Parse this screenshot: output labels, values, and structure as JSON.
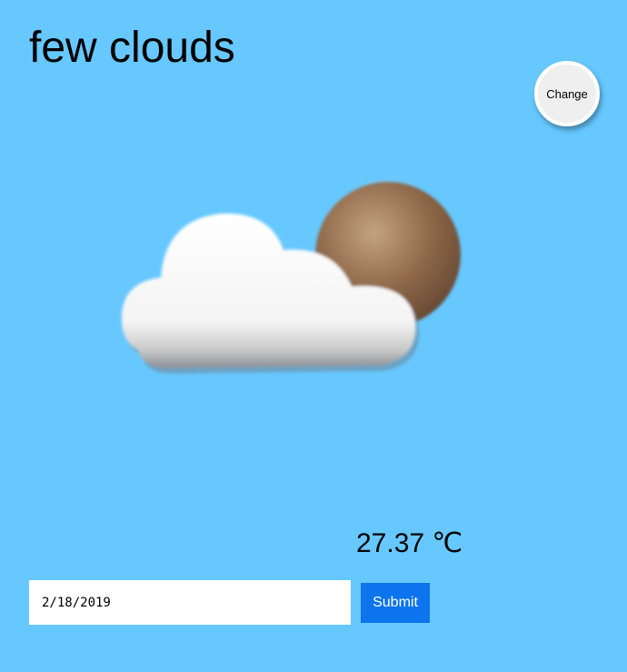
{
  "weather": {
    "description": "few clouds",
    "temperature": "27.37",
    "unit": "℃",
    "icon": "few-clouds-night-icon"
  },
  "controls": {
    "change_label": "Change",
    "date_value": "2/18/2019",
    "submit_label": "Submit"
  },
  "colors": {
    "background": "#66c8ff",
    "submit_button": "#0c74ec",
    "change_button": "#efefef"
  }
}
